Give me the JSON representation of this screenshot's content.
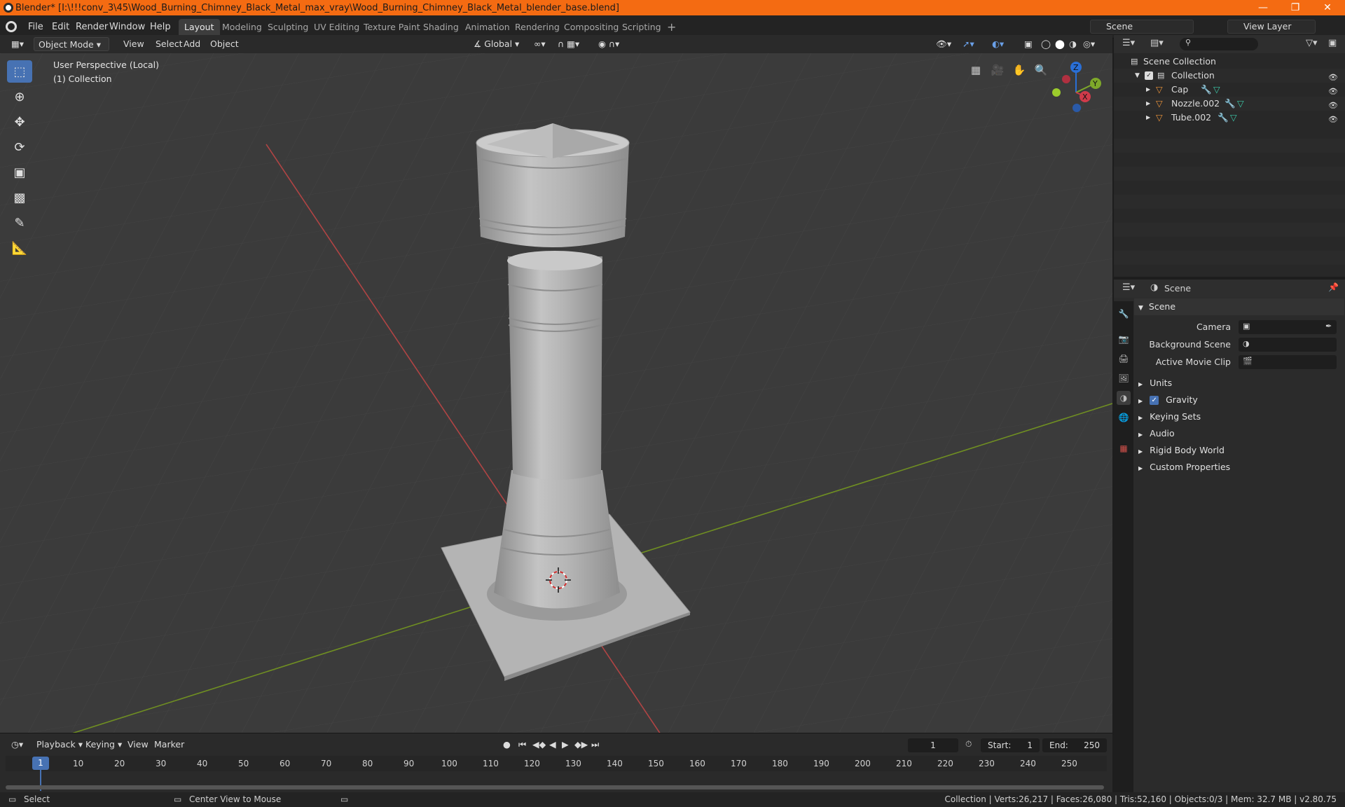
{
  "window": {
    "title": "Blender* [I:\\!!!conv_3\\45\\Wood_Burning_Chimney_Black_Metal_max_vray\\Wood_Burning_Chimney_Black_Metal_blender_base.blend]",
    "controls": [
      "minimize",
      "maximize",
      "close"
    ]
  },
  "menu": [
    "File",
    "Edit",
    "Render",
    "Window",
    "Help"
  ],
  "workspaces": [
    "Layout",
    "Modeling",
    "Sculpting",
    "UV Editing",
    "Texture Paint",
    "Shading",
    "Animation",
    "Rendering",
    "Compositing",
    "Scripting"
  ],
  "active_workspace": "Layout",
  "scene_field": "Scene",
  "view_layer_field": "View Layer",
  "viewport_header": {
    "mode": "Object Mode",
    "menus": [
      "View",
      "Select",
      "Add",
      "Object"
    ],
    "transform_orientation": "Global"
  },
  "viewport": {
    "perspective_label": "User Perspective (Local)",
    "collection_label": "(1) Collection",
    "gizmo_axes": [
      "Z",
      "Y",
      "X"
    ]
  },
  "outliner": {
    "root": "Scene Collection",
    "collection": "Collection",
    "objects": [
      "Cap",
      "Nozzle.002",
      "Tube.002"
    ]
  },
  "properties": {
    "context": "Scene",
    "panel_title": "Scene",
    "fields": [
      {
        "label": "Camera"
      },
      {
        "label": "Background Scene"
      },
      {
        "label": "Active Movie Clip"
      }
    ],
    "sections": [
      "Units",
      "Gravity",
      "Keying Sets",
      "Audio",
      "Rigid Body World",
      "Custom Properties"
    ],
    "gravity_checked": true
  },
  "timeline": {
    "menus": [
      "Playback",
      "Keying",
      "View",
      "Marker"
    ],
    "current_frame": "1",
    "start_label": "Start:",
    "start": "1",
    "end_label": "End:",
    "end": "250",
    "ruler": [
      "1",
      "10",
      "20",
      "30",
      "40",
      "50",
      "60",
      "70",
      "80",
      "90",
      "100",
      "110",
      "120",
      "130",
      "140",
      "150",
      "160",
      "170",
      "180",
      "190",
      "200",
      "210",
      "220",
      "230",
      "240",
      "250"
    ]
  },
  "statusbar": {
    "left": "Select",
    "middle": "Center View to Mouse",
    "right": "Collection | Verts:26,217 | Faces:26,080 | Tris:52,160 | Objects:0/3 | Mem: 32.7 MB | v2.80.75"
  },
  "colors": {
    "titlebar": "#f46b12",
    "accent": "#4772b3",
    "viewport_bg": "#3b3b3b",
    "x_axis": "#c04040",
    "y_axis": "#7a9a2a"
  }
}
